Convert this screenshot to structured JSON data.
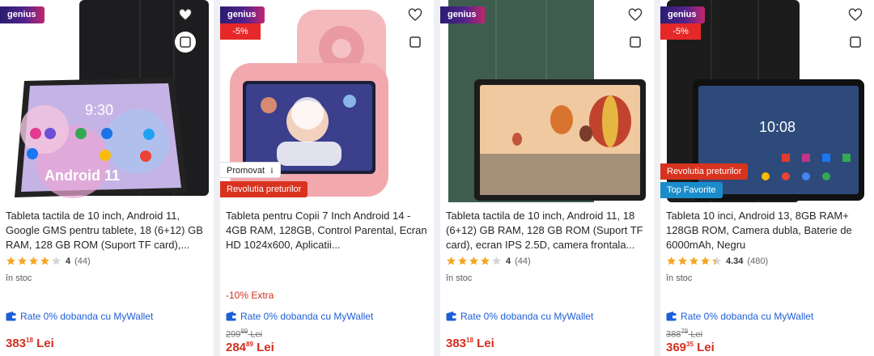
{
  "colors": {
    "price": "#d12f1f",
    "wallet": "#1e5fd8",
    "star": "#f6a623"
  },
  "products": [
    {
      "genius": "genius",
      "discount": "",
      "chips": [],
      "title": "Tableta tactila de 10 inch, Android 11, Google GMS pentru tablete, 18 (6+12) GB RAM, 128 GB ROM (Suport TF card),...",
      "rating": {
        "stars": 4,
        "score": "4",
        "count": "(44)"
      },
      "stock": "în stoc",
      "extra": "",
      "wallet": "Rate 0% dobanda cu MyWallet",
      "old_price": {
        "int": "",
        "dec": "",
        "cur": ""
      },
      "price": {
        "int": "383",
        "dec": "18",
        "cur": "Lei"
      },
      "screen_text": [
        "Android 11",
        "9:30"
      ]
    },
    {
      "genius": "genius",
      "discount": "-5%",
      "chips": [
        "Promovat",
        "Revolutia preturilor"
      ],
      "title": "Tableta pentru Copii 7 Inch Android 14 - 4GB RAM, 128GB, Control Parental, Ecran HD 1024x600, Aplicatii...",
      "rating": null,
      "stock": "",
      "extra": "-10% Extra",
      "wallet": "Rate 0% dobanda cu MyWallet",
      "old_price": {
        "int": "299",
        "dec": "99",
        "cur": "Lei"
      },
      "price": {
        "int": "284",
        "dec": "89",
        "cur": "Lei"
      }
    },
    {
      "genius": "genius",
      "discount": "",
      "chips": [],
      "title": "Tableta tactila de 10 inch, Android 11, 18 (6+12) GB RAM, 128 GB ROM (Suport TF card), ecran IPS 2.5D, camera frontala...",
      "rating": {
        "stars": 4,
        "score": "4",
        "count": "(44)"
      },
      "stock": "în stoc",
      "extra": "",
      "wallet": "Rate 0% dobanda cu MyWallet",
      "old_price": {
        "int": "",
        "dec": "",
        "cur": ""
      },
      "price": {
        "int": "383",
        "dec": "18",
        "cur": "Lei"
      }
    },
    {
      "genius": "genius",
      "discount": "-5%",
      "chips": [
        "Revolutia preturilor",
        "Top Favorite"
      ],
      "title": "Tableta 10 inci, Android 13, 8GB RAM+ 128GB ROM, Camera dubla, Baterie de 6000mAh, Negru",
      "rating": {
        "stars": 4.34,
        "score": "4.34",
        "count": "(480)"
      },
      "stock": "în stoc",
      "extra": "",
      "wallet": "Rate 0% dobanda cu MyWallet",
      "old_price": {
        "int": "388",
        "dec": "78",
        "cur": "Lei"
      },
      "price": {
        "int": "369",
        "dec": "35",
        "cur": "Lei"
      },
      "screen_text": [
        "10:08"
      ]
    }
  ]
}
